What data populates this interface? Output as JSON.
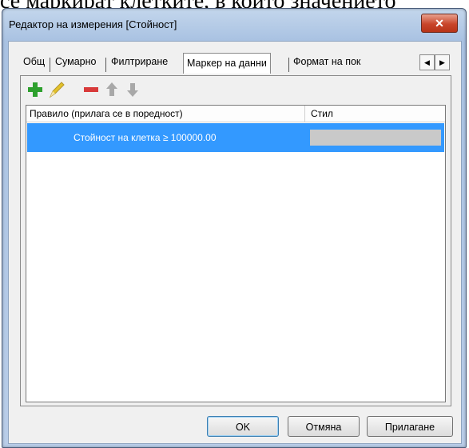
{
  "background_text": "се маркират клетките, в които значението",
  "window": {
    "title": "Редактор на измерения [Стойност]",
    "close_label": "✕"
  },
  "tabs": [
    {
      "label": "Общ",
      "selected": false
    },
    {
      "label": "Сумарно",
      "selected": false
    },
    {
      "label": "Филтриране",
      "selected": false
    },
    {
      "label": "Маркер на данни",
      "selected": true
    },
    {
      "label": "Формат на пок",
      "selected": false
    }
  ],
  "tab_scroll": {
    "left": "◀",
    "right": "▶"
  },
  "toolbar": {
    "icons": [
      "add-icon",
      "edit-icon",
      "remove-icon",
      "move-up-icon",
      "move-down-icon"
    ],
    "colors": {
      "add": "#2ea02e",
      "edit": "#e3c22b",
      "remove": "#d83a3a",
      "arrow": "#a8a8a8"
    }
  },
  "grid": {
    "columns": [
      "Правило (прилага се в поредност)",
      "Стил"
    ],
    "rows": [
      {
        "rule": "Стойност на клетка ≥ 100000.00",
        "style_swatch": "#c9c9c9",
        "selected": true
      }
    ],
    "selection_color": "#3399ff"
  },
  "buttons": {
    "ok": "OK",
    "cancel": "Отмяна",
    "apply": "Прилагане"
  }
}
